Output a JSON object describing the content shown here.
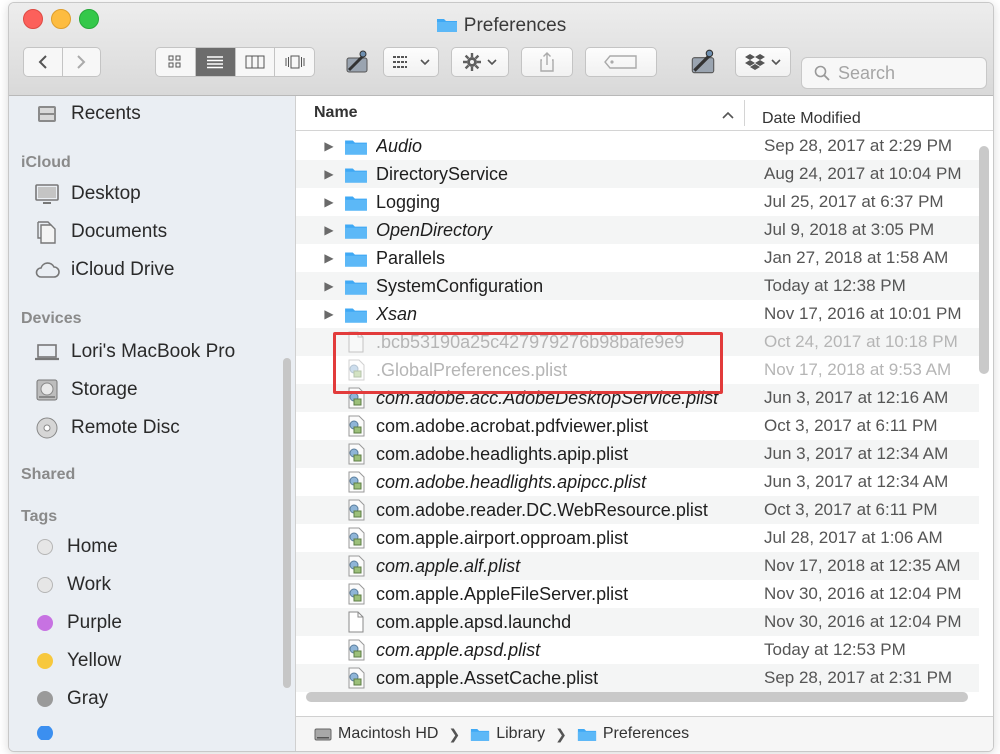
{
  "window": {
    "title": "Preferences"
  },
  "toolbar": {
    "back_icon": "chevron-left-icon",
    "forward_icon": "chevron-right-icon",
    "view_modes": [
      "icon-view",
      "list-view",
      "column-view",
      "cover-flow-view"
    ],
    "active_view": "list-view",
    "search_placeholder": "Search"
  },
  "sidebar": {
    "favorites": [
      {
        "label": "Recents",
        "icon": "recents-icon"
      }
    ],
    "icloud_header": "iCloud",
    "icloud": [
      {
        "label": "Desktop",
        "icon": "desktop-icon"
      },
      {
        "label": "Documents",
        "icon": "documents-icon"
      },
      {
        "label": "iCloud Drive",
        "icon": "cloud-icon"
      }
    ],
    "devices_header": "Devices",
    "devices": [
      {
        "label": "Lori's MacBook Pro",
        "icon": "laptop-icon"
      },
      {
        "label": "Storage",
        "icon": "disk-icon"
      },
      {
        "label": "Remote Disc",
        "icon": "disc-icon"
      }
    ],
    "shared_header": "Shared",
    "tags_header": "Tags",
    "tags": [
      {
        "label": "Home",
        "color": "#e6e6e6"
      },
      {
        "label": "Work",
        "color": "#e6e6e6"
      },
      {
        "label": "Purple",
        "color": "#c772e2"
      },
      {
        "label": "Yellow",
        "color": "#f7c83d"
      },
      {
        "label": "Gray",
        "color": "#9a9a9a"
      }
    ]
  },
  "columns": {
    "name": "Name",
    "date_modified": "Date Modified"
  },
  "files": [
    {
      "name": "Audio",
      "date": "Sep 28, 2017 at 2:29 PM",
      "type": "folder",
      "italic": true
    },
    {
      "name": "DirectoryService",
      "date": "Aug 24, 2017 at 10:04 PM",
      "type": "folder",
      "italic": false
    },
    {
      "name": "Logging",
      "date": "Jul 25, 2017 at 6:37 PM",
      "type": "folder",
      "italic": false
    },
    {
      "name": "OpenDirectory",
      "date": "Jul 9, 2018 at 3:05 PM",
      "type": "folder",
      "italic": true
    },
    {
      "name": "Parallels",
      "date": "Jan 27, 2018 at 1:58 AM",
      "type": "folder",
      "italic": false
    },
    {
      "name": "SystemConfiguration",
      "date": "Today at 12:38 PM",
      "type": "folder",
      "italic": false
    },
    {
      "name": "Xsan",
      "date": "Nov 17, 2016 at 10:01 PM",
      "type": "folder",
      "italic": true
    },
    {
      "name": ".bcb53190a25c427979276b98bafe9e9",
      "date": "Oct 24, 2017 at 10:18 PM",
      "type": "hidden-doc",
      "italic": false
    },
    {
      "name": ".GlobalPreferences.plist",
      "date": "Nov 17, 2018 at 9:53 AM",
      "type": "hidden-plist",
      "italic": false
    },
    {
      "name": "com.adobe.acc.AdobeDesktopService.plist",
      "date": "Jun 3, 2017 at 12:16 AM",
      "type": "plist",
      "italic": true
    },
    {
      "name": "com.adobe.acrobat.pdfviewer.plist",
      "date": "Oct 3, 2017 at 6:11 PM",
      "type": "plist",
      "italic": false
    },
    {
      "name": "com.adobe.headlights.apip.plist",
      "date": "Jun 3, 2017 at 12:34 AM",
      "type": "plist",
      "italic": false
    },
    {
      "name": "com.adobe.headlights.apipcc.plist",
      "date": "Jun 3, 2017 at 12:34 AM",
      "type": "plist",
      "italic": true
    },
    {
      "name": "com.adobe.reader.DC.WebResource.plist",
      "date": "Oct 3, 2017 at 6:11 PM",
      "type": "plist",
      "italic": false
    },
    {
      "name": "com.apple.airport.opproam.plist",
      "date": "Jul 28, 2017 at 1:06 AM",
      "type": "plist",
      "italic": false
    },
    {
      "name": "com.apple.alf.plist",
      "date": "Nov 17, 2018 at 12:35 AM",
      "type": "plist",
      "italic": true
    },
    {
      "name": "com.apple.AppleFileServer.plist",
      "date": "Nov 30, 2016 at 12:04 PM",
      "type": "plist",
      "italic": false
    },
    {
      "name": "com.apple.apsd.launchd",
      "date": "Nov 30, 2016 at 12:04 PM",
      "type": "doc",
      "italic": false
    },
    {
      "name": "com.apple.apsd.plist",
      "date": "Today at 12:53 PM",
      "type": "plist",
      "italic": true
    },
    {
      "name": "com.apple.AssetCache.plist",
      "date": "Sep 28, 2017 at 2:31 PM",
      "type": "plist",
      "italic": false
    }
  ],
  "pathbar": [
    {
      "label": "Macintosh HD",
      "icon": "hard-drive-icon"
    },
    {
      "label": "Library",
      "icon": "folder-icon"
    },
    {
      "label": "Preferences",
      "icon": "folder-icon"
    }
  ],
  "colors": {
    "folder_blue": "#3fa9f5",
    "highlight_red": "#e23b3b",
    "sidebar_bg": "#eaeef3"
  }
}
